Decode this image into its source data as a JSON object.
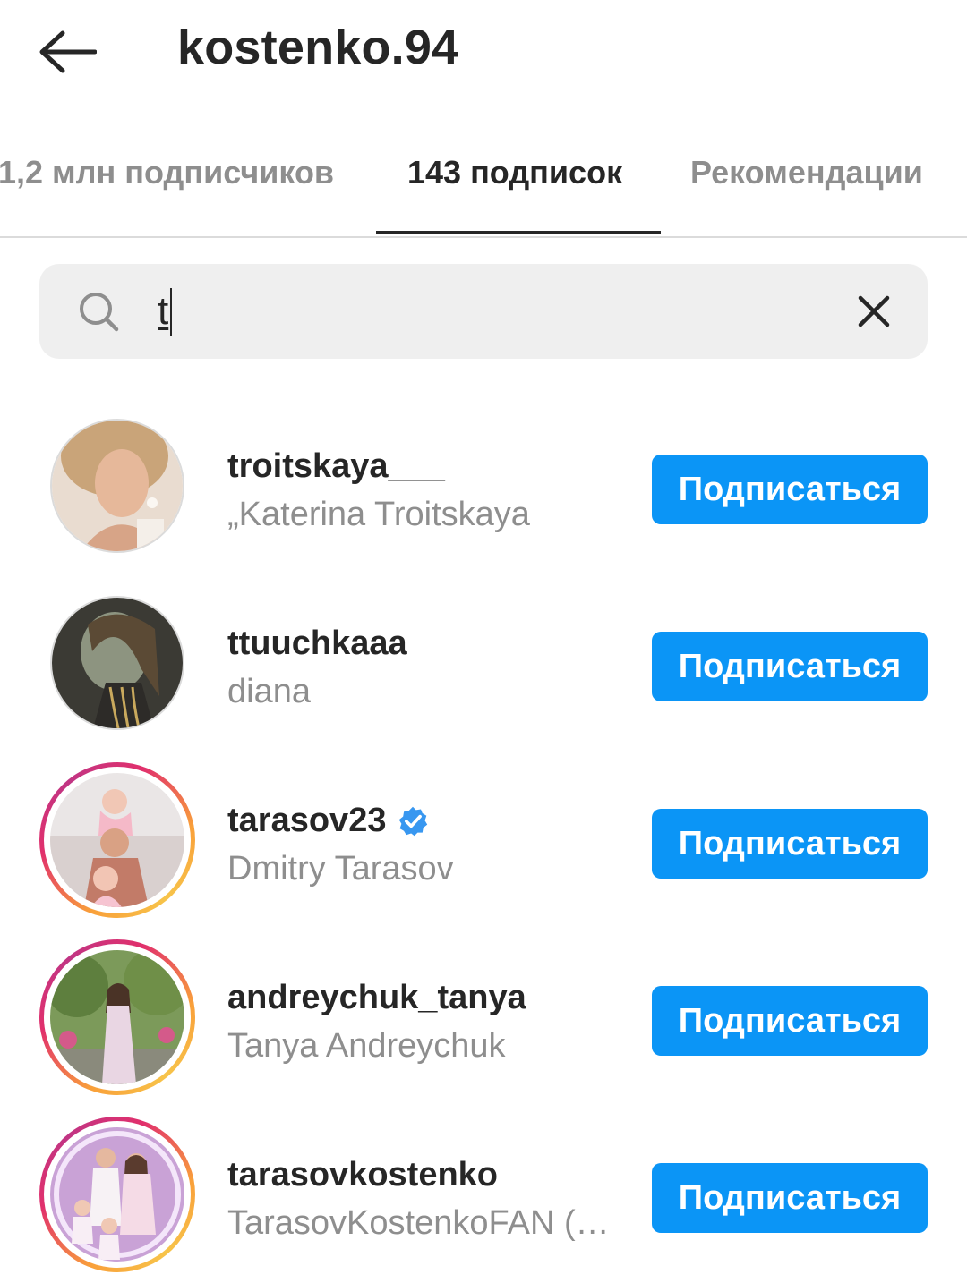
{
  "header": {
    "back_icon": "arrow-left-icon",
    "title": "kostenko.94"
  },
  "tabs": [
    {
      "label": "1,2 млн подписчиков",
      "active": false
    },
    {
      "label": "143 подписок",
      "active": true
    },
    {
      "label": "Рекомендации",
      "active": false
    }
  ],
  "search": {
    "icon": "search-icon",
    "value": "t",
    "clear_icon": "close-icon"
  },
  "colors": {
    "follow_button": "#0b95f6",
    "muted_text": "#8e8e8e",
    "primary_text": "#262626",
    "verified_badge": "#3897f0"
  },
  "accounts": [
    {
      "username": "troitskaya___",
      "full_name": "„Katerina Troitskaya",
      "verified": false,
      "story_ring": false,
      "button": "Подписаться"
    },
    {
      "username": "ttuuchkaaa",
      "full_name": "diana",
      "verified": false,
      "story_ring": false,
      "button": "Подписаться"
    },
    {
      "username": "tarasov23",
      "full_name": "Dmitry Tarasov",
      "verified": true,
      "story_ring": true,
      "button": "Подписаться"
    },
    {
      "username": "andreychuk_tanya",
      "full_name": "Tanya Andreychuk",
      "verified": false,
      "story_ring": true,
      "button": "Подписаться"
    },
    {
      "username": "tarasovkostenko",
      "full_name": "TarasovKostenkoFAN (…",
      "verified": false,
      "story_ring": true,
      "button": "Подписаться"
    }
  ]
}
